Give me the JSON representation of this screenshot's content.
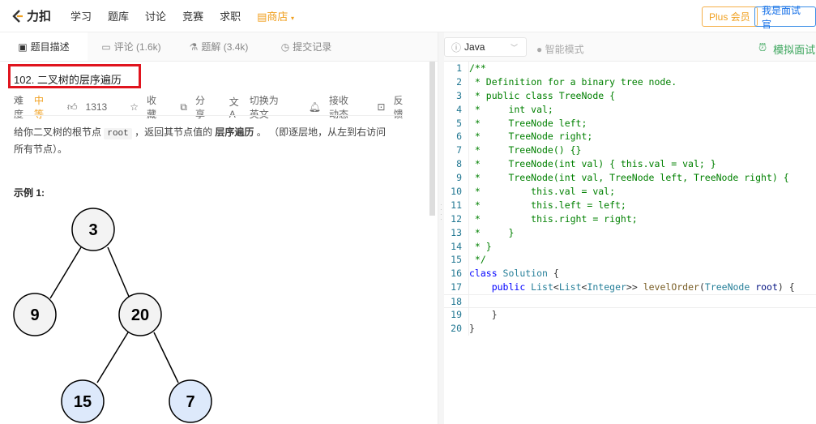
{
  "nav": {
    "logo": "力扣",
    "items": [
      "学习",
      "题库",
      "讨论",
      "竞赛",
      "求职"
    ],
    "shop": "商店",
    "plus": "Plus 会员",
    "interviewer": "我是面试官"
  },
  "tabs": [
    {
      "label": "题目描述",
      "icon": "description-icon"
    },
    {
      "label": "评论 (1.6k)",
      "icon": "comment-icon"
    },
    {
      "label": "题解 (3.4k)",
      "icon": "flask-icon"
    },
    {
      "label": "提交记录",
      "icon": "clock-icon"
    }
  ],
  "problem": {
    "title": "102. 二叉树的层序遍历",
    "difficulty_label": "难度",
    "difficulty": "中等",
    "likes": "1313",
    "favorite": "收藏",
    "share": "分享",
    "switch_lang": "切换为英文",
    "subscribe": "接收动态",
    "feedback": "反馈",
    "desc_1": "给你二叉树的根节点 ",
    "desc_code": "root",
    "desc_2": " ，返回其节点值的 ",
    "desc_bold": "层序遍历",
    "desc_3": " 。 （即逐层地，从左到右访问所有节点）。",
    "example_title": "示例 1:",
    "tree": {
      "nodes": [
        "3",
        "9",
        "20",
        "15",
        "7"
      ],
      "highlight_color": "#dde9fb"
    }
  },
  "editor": {
    "language": "Java",
    "smart_mode": "智能模式",
    "mock_interview": "模拟面试",
    "lines": [
      [
        [
          "c",
          "/**"
        ]
      ],
      [
        [
          "c",
          " * Definition for a binary tree node."
        ]
      ],
      [
        [
          "c",
          " * public class TreeNode {"
        ]
      ],
      [
        [
          "c",
          " *     int val;"
        ]
      ],
      [
        [
          "c",
          " *     TreeNode left;"
        ]
      ],
      [
        [
          "c",
          " *     TreeNode right;"
        ]
      ],
      [
        [
          "c",
          " *     TreeNode() {}"
        ]
      ],
      [
        [
          "c",
          " *     TreeNode(int val) { this.val = val; }"
        ]
      ],
      [
        [
          "c",
          " *     TreeNode(int val, TreeNode left, TreeNode right) {"
        ]
      ],
      [
        [
          "c",
          " *         this.val = val;"
        ]
      ],
      [
        [
          "c",
          " *         this.left = left;"
        ]
      ],
      [
        [
          "c",
          " *         this.right = right;"
        ]
      ],
      [
        [
          "c",
          " *     }"
        ]
      ],
      [
        [
          "c",
          " * }"
        ]
      ],
      [
        [
          "c",
          " */"
        ]
      ],
      [
        [
          "k",
          "class "
        ],
        [
          "t",
          "Solution"
        ],
        [
          "p",
          " {"
        ]
      ],
      [
        [
          "p",
          "    "
        ],
        [
          "k",
          "public "
        ],
        [
          "t",
          "List"
        ],
        [
          "p",
          "<"
        ],
        [
          "t",
          "List"
        ],
        [
          "p",
          "<"
        ],
        [
          "t",
          "Integer"
        ],
        [
          "p",
          ">> "
        ],
        [
          "f",
          "levelOrder"
        ],
        [
          "p",
          "("
        ],
        [
          "t",
          "TreeNode "
        ],
        [
          "v",
          "root"
        ],
        [
          "p",
          ") {"
        ]
      ],
      [
        [
          "p",
          ""
        ]
      ],
      [
        [
          "p",
          "    }"
        ]
      ],
      [
        [
          "p",
          "}"
        ]
      ]
    ]
  }
}
